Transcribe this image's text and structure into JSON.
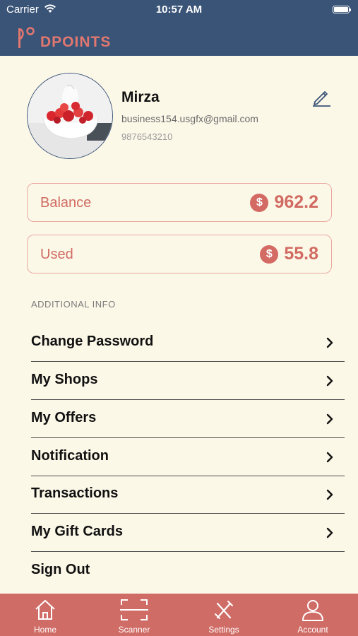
{
  "status_bar": {
    "carrier": "Carrier",
    "time": "10:57 AM"
  },
  "app": {
    "brand": "DPOINTS"
  },
  "profile": {
    "name": "Mirza",
    "email": "business154.usgfx@gmail.com",
    "phone": "9876543210"
  },
  "balance": {
    "label": "Balance",
    "value": "962.2",
    "currency_symbol": "$"
  },
  "used": {
    "label": "Used",
    "value": "55.8",
    "currency_symbol": "$"
  },
  "section_title": "ADDITIONAL INFO",
  "menu": [
    {
      "label": "Change Password"
    },
    {
      "label": "My Shops"
    },
    {
      "label": "My Offers"
    },
    {
      "label": "Notification"
    },
    {
      "label": "Transactions"
    },
    {
      "label": "My Gift Cards"
    },
    {
      "label": "Sign Out"
    }
  ],
  "tabs": [
    {
      "label": "Home",
      "icon": "home-icon"
    },
    {
      "label": "Scanner",
      "icon": "scanner-icon"
    },
    {
      "label": "Settings",
      "icon": "settings-icon"
    },
    {
      "label": "Account",
      "icon": "account-icon"
    }
  ],
  "colors": {
    "header": "#3A5478",
    "background": "#FCF8E8",
    "accent": "#D06C66"
  }
}
